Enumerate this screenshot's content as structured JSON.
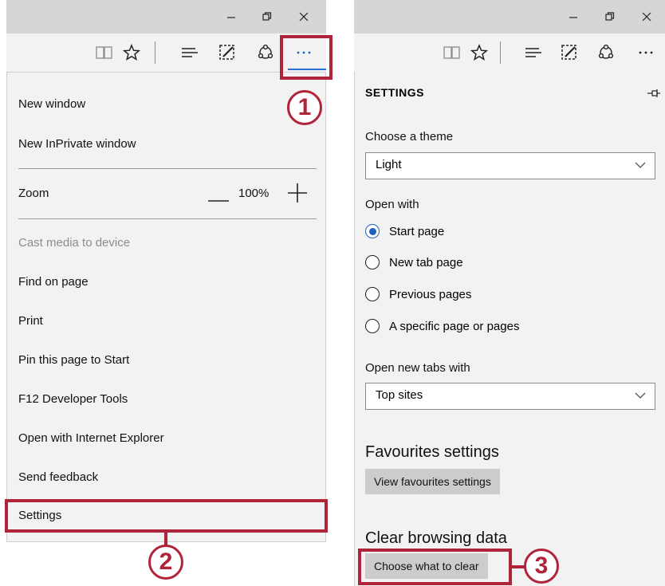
{
  "left": {
    "menu_items": {
      "new_window": "New window",
      "new_inprivate": "New InPrivate window",
      "zoom_label": "Zoom",
      "zoom_value": "100%",
      "cast": "Cast media to device",
      "find": "Find on page",
      "print": "Print",
      "pin": "Pin this page to Start",
      "devtools": "F12 Developer Tools",
      "open_ie": "Open with Internet Explorer",
      "feedback": "Send feedback",
      "settings": "Settings"
    }
  },
  "right": {
    "settings": {
      "title": "SETTINGS",
      "choose_theme_label": "Choose a theme",
      "theme_value": "Light",
      "open_with_label": "Open with",
      "open_with_options": [
        "Start page",
        "New tab page",
        "Previous pages",
        "A specific page or pages"
      ],
      "open_with_selected": "Start page",
      "new_tabs_label": "Open new tabs with",
      "new_tabs_value": "Top sites",
      "favourites_heading": "Favourites settings",
      "favourites_button": "View favourites settings",
      "clear_heading": "Clear browsing data",
      "clear_button": "Choose what to clear"
    }
  },
  "annotations": {
    "step1": "1",
    "step2": "2",
    "step3": "3",
    "color": "#b0243a"
  },
  "colors": {
    "accent": "#1f5fbf",
    "titlebar": "#d6d6d6",
    "panel_bg": "#f2f2f2",
    "button_bg": "#cccccc"
  }
}
